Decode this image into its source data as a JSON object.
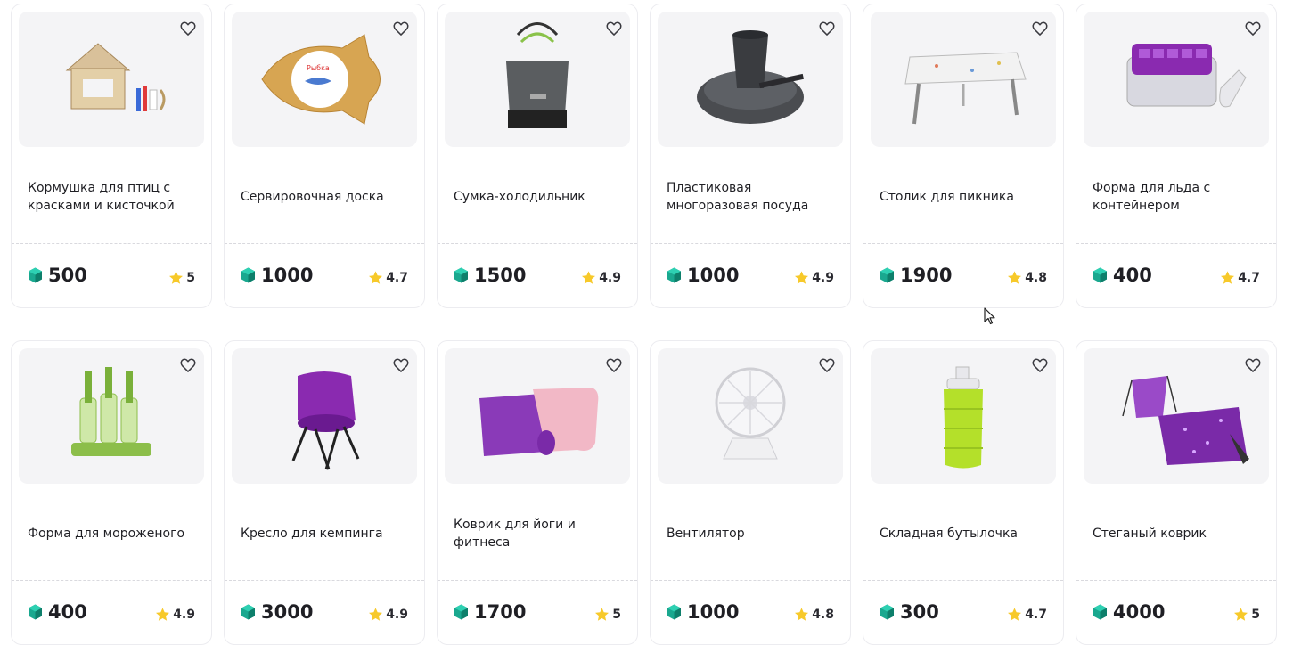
{
  "colors": {
    "gem": "#1aa88f",
    "star": "#f7c92a",
    "heart": "#3a3a40",
    "card_border": "#ececf0",
    "image_bg": "#f4f4f6"
  },
  "products": [
    {
      "title": "Кормушка для птиц с красками и кисточкой",
      "price": "500",
      "rating": "5",
      "icon": "bird-feeder-icon"
    },
    {
      "title": "Сервировочная доска",
      "price": "1000",
      "rating": "4.7",
      "icon": "fish-board-icon"
    },
    {
      "title": "Сумка-холодильник",
      "price": "1500",
      "rating": "4.9",
      "icon": "cooler-bag-icon"
    },
    {
      "title": "Пластиковая многоразовая посуда",
      "price": "1000",
      "rating": "4.9",
      "icon": "dishware-icon"
    },
    {
      "title": "Столик для пикника",
      "price": "1900",
      "rating": "4.8",
      "icon": "picnic-table-icon"
    },
    {
      "title": "Форма для льда с контейнером",
      "price": "400",
      "rating": "4.7",
      "icon": "ice-tray-icon"
    },
    {
      "title": "Форма для мороженого",
      "price": "400",
      "rating": "4.9",
      "icon": "popsicle-mold-icon"
    },
    {
      "title": "Кресло для кемпинга",
      "price": "3000",
      "rating": "4.9",
      "icon": "camping-chair-icon"
    },
    {
      "title": "Коврик для йоги и фитнеса",
      "price": "1700",
      "rating": "5",
      "icon": "yoga-mat-icon"
    },
    {
      "title": "Вентилятор",
      "price": "1000",
      "rating": "4.8",
      "icon": "fan-icon"
    },
    {
      "title": "Складная бутылочка",
      "price": "300",
      "rating": "4.7",
      "icon": "bottle-icon"
    },
    {
      "title": "Стеганый коврик",
      "price": "4000",
      "rating": "5",
      "icon": "blanket-icon"
    }
  ]
}
